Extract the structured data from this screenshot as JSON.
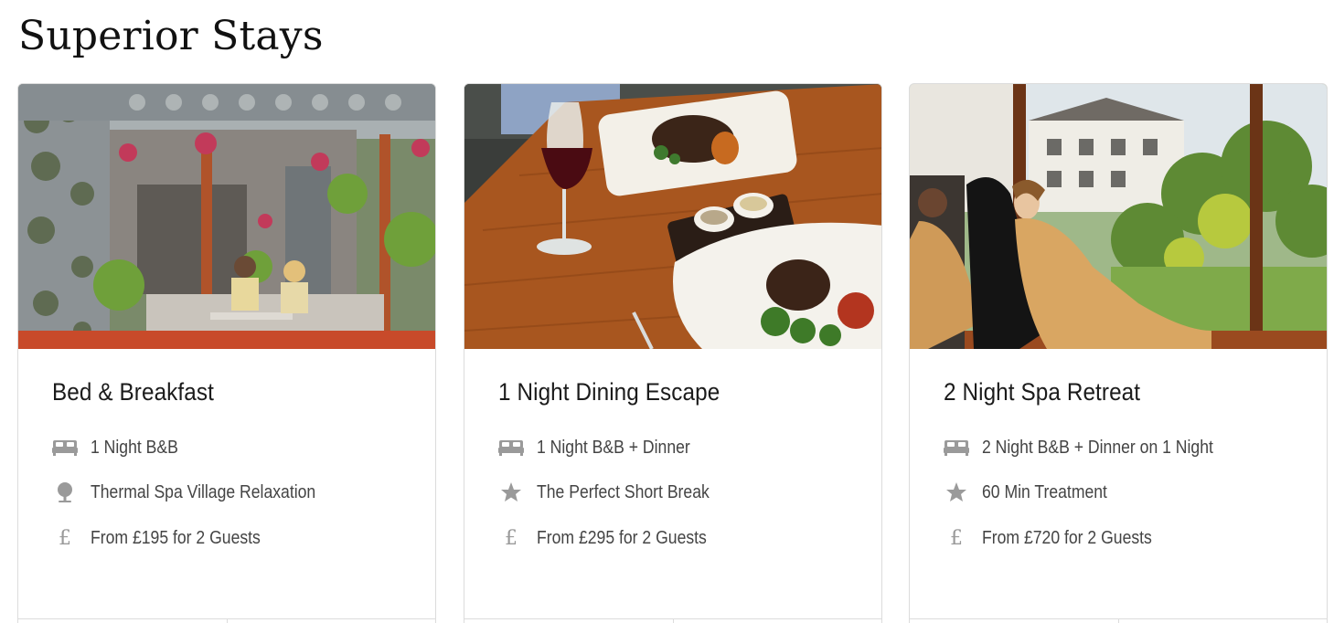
{
  "section": {
    "title": "Superior Stays"
  },
  "colors": {
    "icon_gray": "#9a9a9a",
    "text": "#444444",
    "border": "#dcdcdc"
  },
  "cards": [
    {
      "title": "Bed & Breakfast",
      "image": "garden-terrace-couple-drinks",
      "features": [
        {
          "icon": "bed-icon",
          "text": "1 Night B&B"
        },
        {
          "icon": "location-pin-icon",
          "text": "Thermal Spa Village Relaxation"
        },
        {
          "icon": "pound-icon",
          "symbol": "£",
          "text": "From £195 for 2 Guests"
        }
      ]
    },
    {
      "title": "1 Night Dining Escape",
      "image": "steak-dinner-red-wine",
      "features": [
        {
          "icon": "bed-icon",
          "text": "1 Night B&B + Dinner"
        },
        {
          "icon": "star-icon",
          "text": "The Perfect Short Break"
        },
        {
          "icon": "pound-icon",
          "symbol": "£",
          "text": "From £295 for 2 Guests"
        }
      ]
    },
    {
      "title": "2 Night Spa Retreat",
      "image": "spa-relaxation-loungers",
      "features": [
        {
          "icon": "bed-icon",
          "text": "2 Night B&B + Dinner on 1 Night"
        },
        {
          "icon": "star-icon",
          "text": "60 Min Treatment"
        },
        {
          "icon": "pound-icon",
          "symbol": "£",
          "text": "From £720 for 2 Guests"
        }
      ]
    }
  ]
}
